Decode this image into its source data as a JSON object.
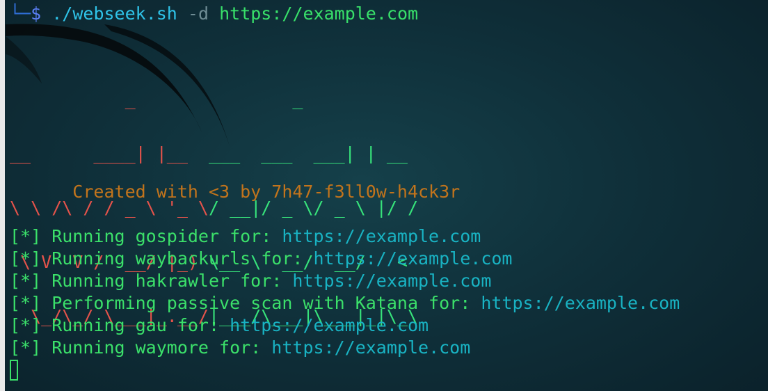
{
  "command": {
    "prompt_frame": "└─",
    "prompt_symbol": "$",
    "script": "./webseek.sh",
    "flag": "-d",
    "url": "https://example.com"
  },
  "banner": {
    "rows": [
      {
        "red": "           _ ",
        "green": "              _ "
      },
      {
        "red": "__      ____| |__  ",
        "green": "___  ___  ___| | __"
      },
      {
        "red": "\\ \\ /\\ / / _ \\ '_ \\",
        "green": "/ __|/ _ \\/ _ \\ |/ /"
      },
      {
        "red": " \\ V  V /  __/ |_) ",
        "green": "\\__ \\  __/  __/   <"
      },
      {
        "red": "  \\_/\\_/ \\___|_.__/",
        "green": "|___/\\___|\\___|_|\\_\\"
      }
    ],
    "credit": "      Created with <3 by 7h47-f3ll0w-h4ck3r"
  },
  "output": [
    {
      "bracket": "[*]",
      "text": " Running gospider for: ",
      "url": "https://example.com"
    },
    {
      "bracket": "[*]",
      "text": " Running waybackurls for: ",
      "url": "https://example.com"
    },
    {
      "bracket": "[*]",
      "text": " Running hakrawler for: ",
      "url": "https://example.com"
    },
    {
      "bracket": "[*]",
      "text": " Performing passive scan with Katana for: ",
      "url": "https://example.com"
    },
    {
      "bracket": "[*]",
      "text": " Running gau for: ",
      "url": "https://example.com"
    },
    {
      "bracket": "[*]",
      "text": " Running waymore for: ",
      "url": "https://example.com"
    }
  ],
  "colors": {
    "background": "#0f2f39",
    "banner_red": "#e5534b",
    "banner_green": "#37e37b",
    "credit": "#c2741c",
    "url": "#19b3c3"
  }
}
